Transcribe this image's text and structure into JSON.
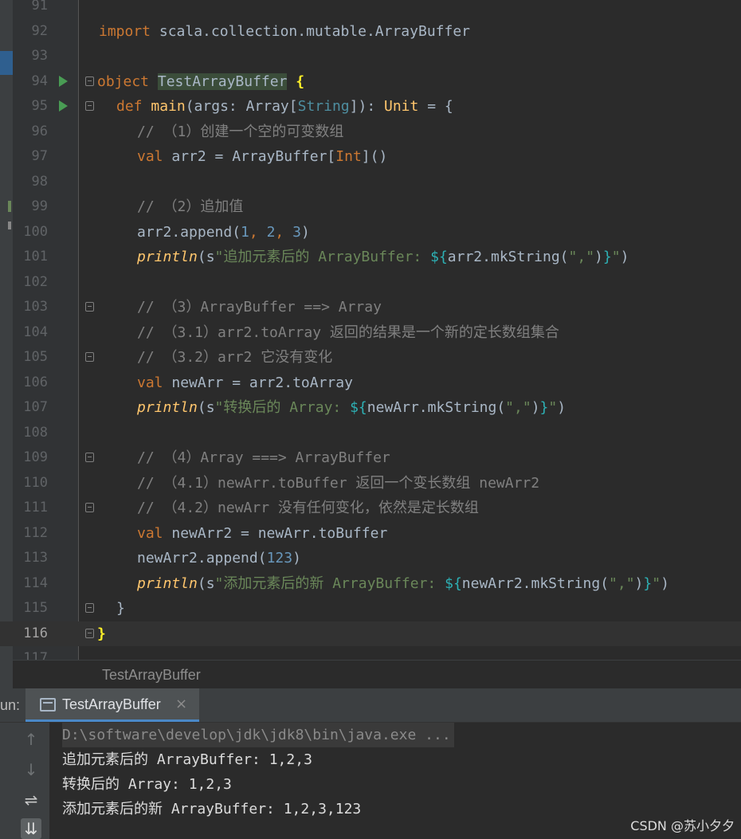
{
  "editor": {
    "current_line": "116",
    "lines": [
      {
        "n": "91"
      },
      {
        "n": "92"
      },
      {
        "n": "93"
      },
      {
        "n": "94"
      },
      {
        "n": "95"
      },
      {
        "n": "96"
      },
      {
        "n": "97"
      },
      {
        "n": "98"
      },
      {
        "n": "99"
      },
      {
        "n": "100"
      },
      {
        "n": "101"
      },
      {
        "n": "102"
      },
      {
        "n": "103"
      },
      {
        "n": "104"
      },
      {
        "n": "105"
      },
      {
        "n": "106"
      },
      {
        "n": "107"
      },
      {
        "n": "108"
      },
      {
        "n": "109"
      },
      {
        "n": "110"
      },
      {
        "n": "111"
      },
      {
        "n": "112"
      },
      {
        "n": "113"
      },
      {
        "n": "114"
      },
      {
        "n": "115"
      },
      {
        "n": "116"
      },
      {
        "n": "117"
      }
    ],
    "code": {
      "l92_import": "import",
      "l92_path": " scala.collection.mutable.ArrayBuffer",
      "l94_object": "object",
      "l94_name": "TestArrayBuffer",
      "l94_brace": "{",
      "l95_def": "def",
      "l95_main": "main",
      "l95_args": "(args: Array[",
      "l95_string": "String",
      "l95_ret": "]): ",
      "l95_unit": "Unit",
      "l95_eq": " = {",
      "l96_cmt": "// （1）创建一个空的可变数组",
      "l97_val": "val",
      "l97_mid": " arr2 = ArrayBuffer[",
      "l97_int": "Int",
      "l97_end": "]()",
      "l99_cmt": "// （2）追加值",
      "l100_a": "arr2.append(",
      "l100_n1": "1",
      "l100_c1": ", ",
      "l100_n2": "2",
      "l100_c2": ", ",
      "l100_n3": "3",
      "l100_e": ")",
      "l101_println": "println",
      "l101_open": "(s",
      "l101_str": "\"追加元素后的 ArrayBuffer: ",
      "l101_int_open": "${",
      "l101_expr": "arr2.mkString(",
      "l101_sep": "\",\"",
      "l101_expr_close": ")",
      "l101_int_close": "}",
      "l101_str_end": "\"",
      "l101_close": ")",
      "l103_cmt": "// （3）ArrayBuffer ==> Array",
      "l104_cmt": "// （3.1）arr2.toArray 返回的结果是一个新的定长数组集合",
      "l105_cmt": "// （3.2）arr2 它没有变化",
      "l106_val": "val",
      "l106_rest": " newArr = arr2.toArray",
      "l107_println": "println",
      "l107_open": "(s",
      "l107_str": "\"转换后的 Array: ",
      "l107_int_open": "${",
      "l107_expr": "newArr.mkString(",
      "l107_sep": "\",\"",
      "l107_expr_close": ")",
      "l107_int_close": "}",
      "l107_str_end": "\"",
      "l107_close": ")",
      "l109_cmt": "// （4）Array ===> ArrayBuffer",
      "l110_cmt": "// （4.1）newArr.toBuffer 返回一个变长数组 newArr2",
      "l111_cmt": "// （4.2）newArr 没有任何变化，依然是定长数组",
      "l112_val": "val",
      "l112_rest": " newArr2 = newArr.toBuffer",
      "l113_a": "newArr2.append(",
      "l113_n": "123",
      "l113_e": ")",
      "l114_println": "println",
      "l114_open": "(s",
      "l114_str": "\"添加元素后的新 ArrayBuffer: ",
      "l114_int_open": "${",
      "l114_expr": "newArr2.mkString(",
      "l114_sep": "\",\"",
      "l114_expr_close": ")",
      "l114_int_close": "}",
      "l114_str_end": "\"",
      "l114_close": ")",
      "l115_brace": "}",
      "l116_brace": "}"
    }
  },
  "breadcrumb": {
    "text": "TestArrayBuffer"
  },
  "run_panel": {
    "label": "un:",
    "tab_label": "TestArrayBuffer",
    "tab_close": "×",
    "tools": {
      "up": "↑",
      "down": "↓",
      "wrap": "⇌",
      "scroll_end": "⇊"
    },
    "console": [
      "D:\\software\\develop\\jdk\\jdk8\\bin\\java.exe ...",
      "追加元素后的 ArrayBuffer: 1,2,3",
      "转换后的 Array: 1,2,3",
      "添加元素后的新 ArrayBuffer: 1,2,3,123"
    ]
  },
  "watermark": "CSDN @苏小夕夕",
  "colors": {
    "keyword": "#cc7832",
    "string": "#6a8759",
    "number": "#6897bb",
    "comment": "#808080",
    "function": "#ffc66d",
    "background": "#2b2b2b"
  }
}
